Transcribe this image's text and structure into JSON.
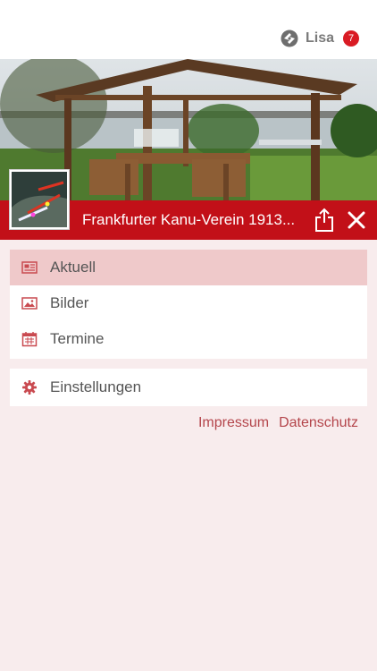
{
  "header": {
    "user_name": "Lisa",
    "notification_count": "7",
    "icon": "app-logo-icon"
  },
  "club": {
    "name": "Frankfurter Kanu-Verein 1913...",
    "share_icon": "share-icon",
    "close_icon": "close-icon",
    "accent": "#c21018"
  },
  "menu": {
    "items": [
      {
        "label": "Aktuell",
        "icon": "newspaper-icon",
        "active": true
      },
      {
        "label": "Bilder",
        "icon": "image-icon",
        "active": false
      },
      {
        "label": "Termine",
        "icon": "calendar-icon",
        "active": false
      }
    ],
    "settings": {
      "label": "Einstellungen",
      "icon": "gear-icon"
    }
  },
  "footer_links": {
    "impressum": "Impressum",
    "datenschutz": "Datenschutz"
  },
  "colors": {
    "background": "#f8eced",
    "active_item": "#efc9ca",
    "link": "#b4454b",
    "icon": "#c94a50"
  }
}
